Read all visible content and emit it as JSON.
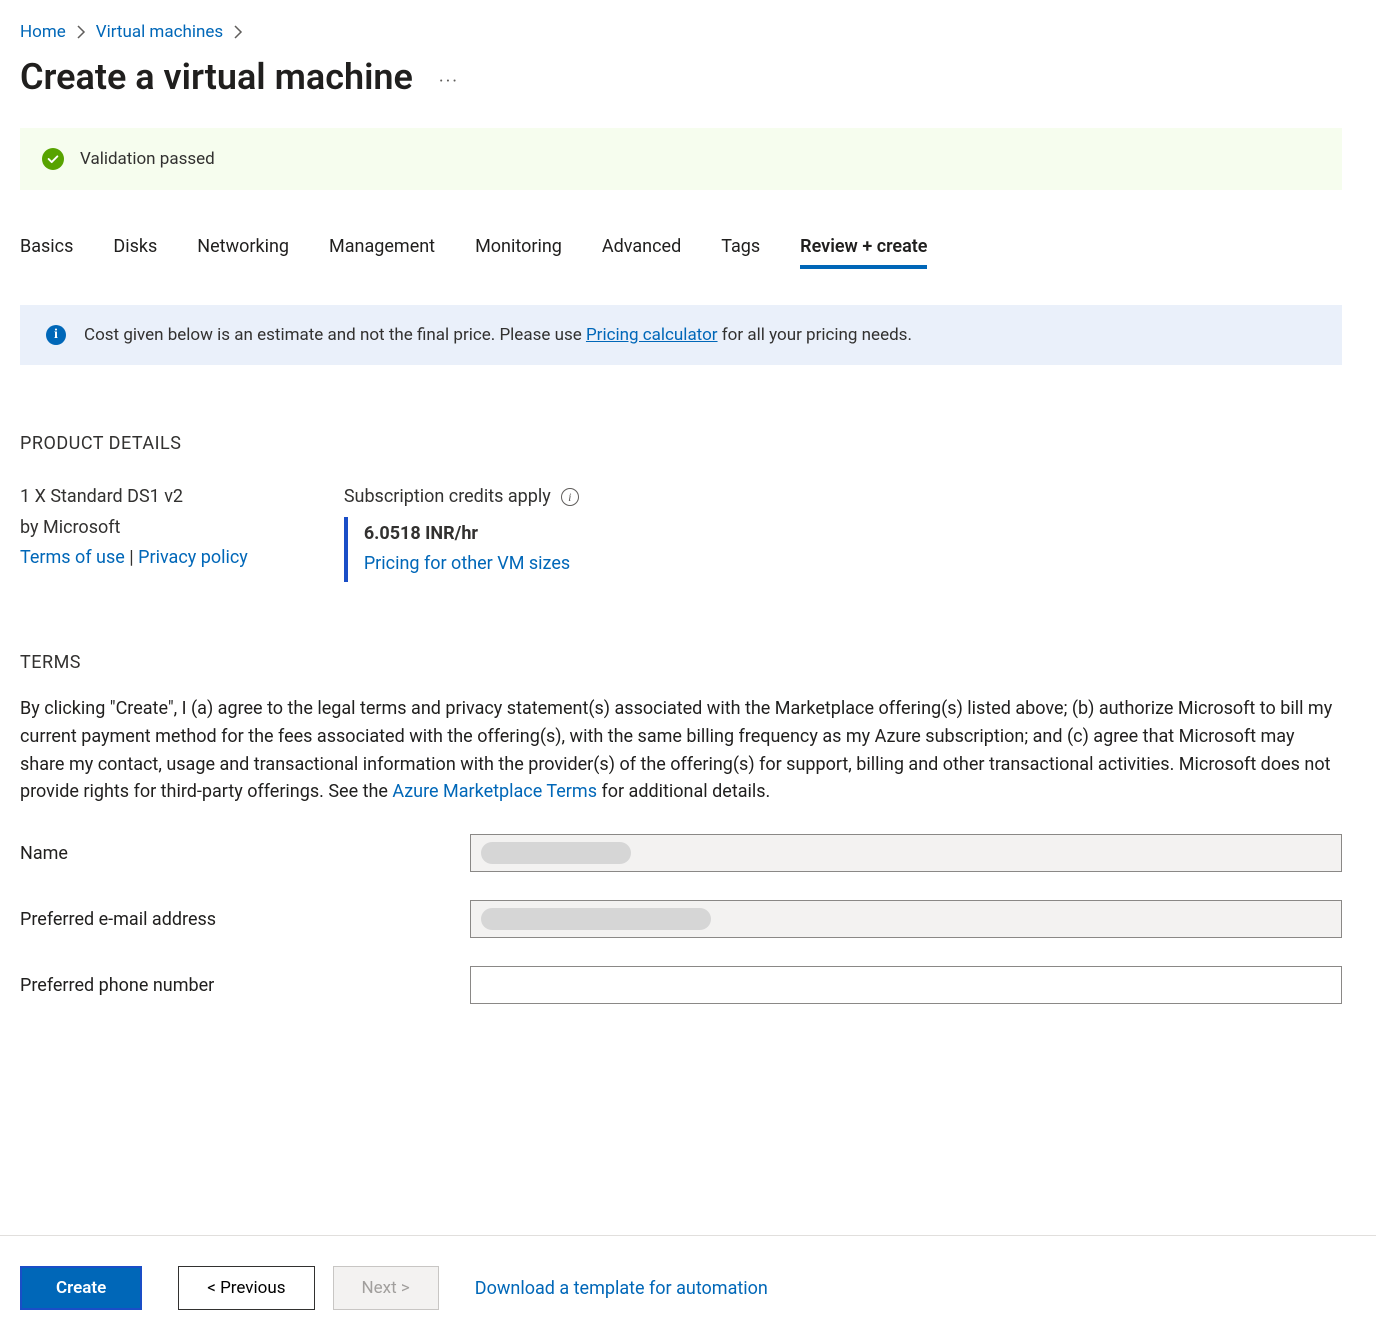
{
  "breadcrumb": {
    "home": "Home",
    "vms": "Virtual machines"
  },
  "page_title": "Create a virtual machine",
  "validation": {
    "text": "Validation passed"
  },
  "tabs": {
    "basics": "Basics",
    "disks": "Disks",
    "networking": "Networking",
    "management": "Management",
    "monitoring": "Monitoring",
    "advanced": "Advanced",
    "tags": "Tags",
    "review": "Review + create"
  },
  "info_banner": {
    "before_link": "Cost given below is an estimate and not the final price. Please use ",
    "link_text": "Pricing calculator",
    "after_link": " for all your pricing needs."
  },
  "product": {
    "heading": "PRODUCT DETAILS",
    "name": "1 X Standard DS1 v2",
    "by_line": "by Microsoft",
    "terms_link": "Terms of use",
    "privacy_link": "Privacy policy",
    "credits_apply": "Subscription credits apply",
    "price": "6.0518 INR/hr",
    "pricing_link": "Pricing for other VM sizes"
  },
  "terms": {
    "heading": "TERMS",
    "body_before_link": "By clicking \"Create\", I (a) agree to the legal terms and privacy statement(s) associated with the Marketplace offering(s) listed above; (b) authorize Microsoft to bill my current payment method for the fees associated with the offering(s), with the same billing frequency as my Azure subscription; and (c) agree that Microsoft may share my contact, usage and transactional information with the provider(s) of the offering(s) for support, billing and other transactional activities. Microsoft does not provide rights for third-party offerings. See the ",
    "marketplace_link": "Azure Marketplace Terms",
    "body_after_link": " for additional details."
  },
  "form": {
    "name_label": "Name",
    "email_label": "Preferred e-mail address",
    "phone_label": "Preferred phone number",
    "name_value": "",
    "email_value": "",
    "phone_value": ""
  },
  "footer": {
    "create": "Create",
    "previous": "< Previous",
    "next": "Next >",
    "download": "Download a template for automation"
  }
}
